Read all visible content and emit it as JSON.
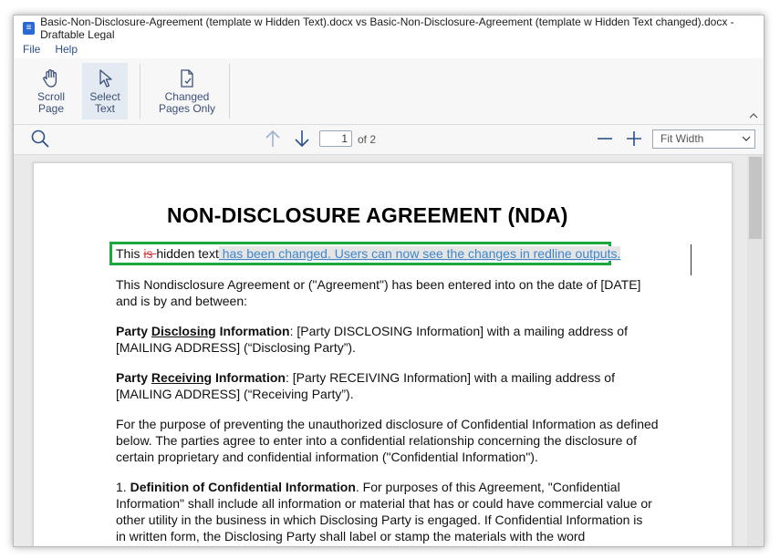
{
  "window": {
    "title": "Basic-Non-Disclosure-Agreement (template w Hidden Text).docx vs Basic-Non-Disclosure-Agreement (template w Hidden Text changed).docx - Draftable Legal"
  },
  "menu": {
    "file": "File",
    "help": "Help"
  },
  "ribbon": {
    "scroll_page": [
      "Scroll",
      "Page"
    ],
    "select_text": [
      "Select",
      "Text"
    ],
    "changed_pages_only": [
      "Changed",
      "Pages Only"
    ]
  },
  "toolbar": {
    "current_page": "1",
    "page_of": "of 2",
    "zoom": "Fit Width"
  },
  "document": {
    "title": "NON-DISCLOSURE AGREEMENT (NDA)",
    "hidden_line": {
      "prefix": "This ",
      "deleted": "is ",
      "kept": "hidden text",
      "inserted": " has been changed. Users can now see the changes in redline outputs."
    },
    "p1": "This Nondisclosure Agreement or (\"Agreement\") has been entered into on the date of [DATE] and is by and between:",
    "p2": {
      "word1": "Party ",
      "underlined": "Disclosing",
      "word2": " Information",
      "rest": ": [Party DISCLOSING Information] with a mailing address of [MAILING ADDRESS] (“Disclosing Party”)."
    },
    "p3": {
      "word1": "Party ",
      "underlined": "Receiving",
      "word2": " Information",
      "rest": ": [Party RECEIVING Information] with a mailing address of [MAILING ADDRESS] (“Receiving Party”)."
    },
    "p4": "For the purpose of preventing the unauthorized disclosure of Confidential Information as defined below. The parties agree to enter into a confidential relationship concerning the disclosure of certain proprietary and confidential information (\"Confidential Information\").",
    "p5": {
      "number": "1. ",
      "heading": "Definition of Confidential Information",
      "rest": ". For purposes of this Agreement, \"Confidential Information\" shall include all information or material that has or could have commercial value or other utility in the business in which Disclosing Party is engaged. If Confidential Information is in written form, the Disclosing Party shall label or stamp the materials with the word \"Confidential\""
    }
  },
  "colors": {
    "deleted": "#d53838",
    "inserted": "#3f86c9",
    "highlight_box": "#1ba83e"
  }
}
